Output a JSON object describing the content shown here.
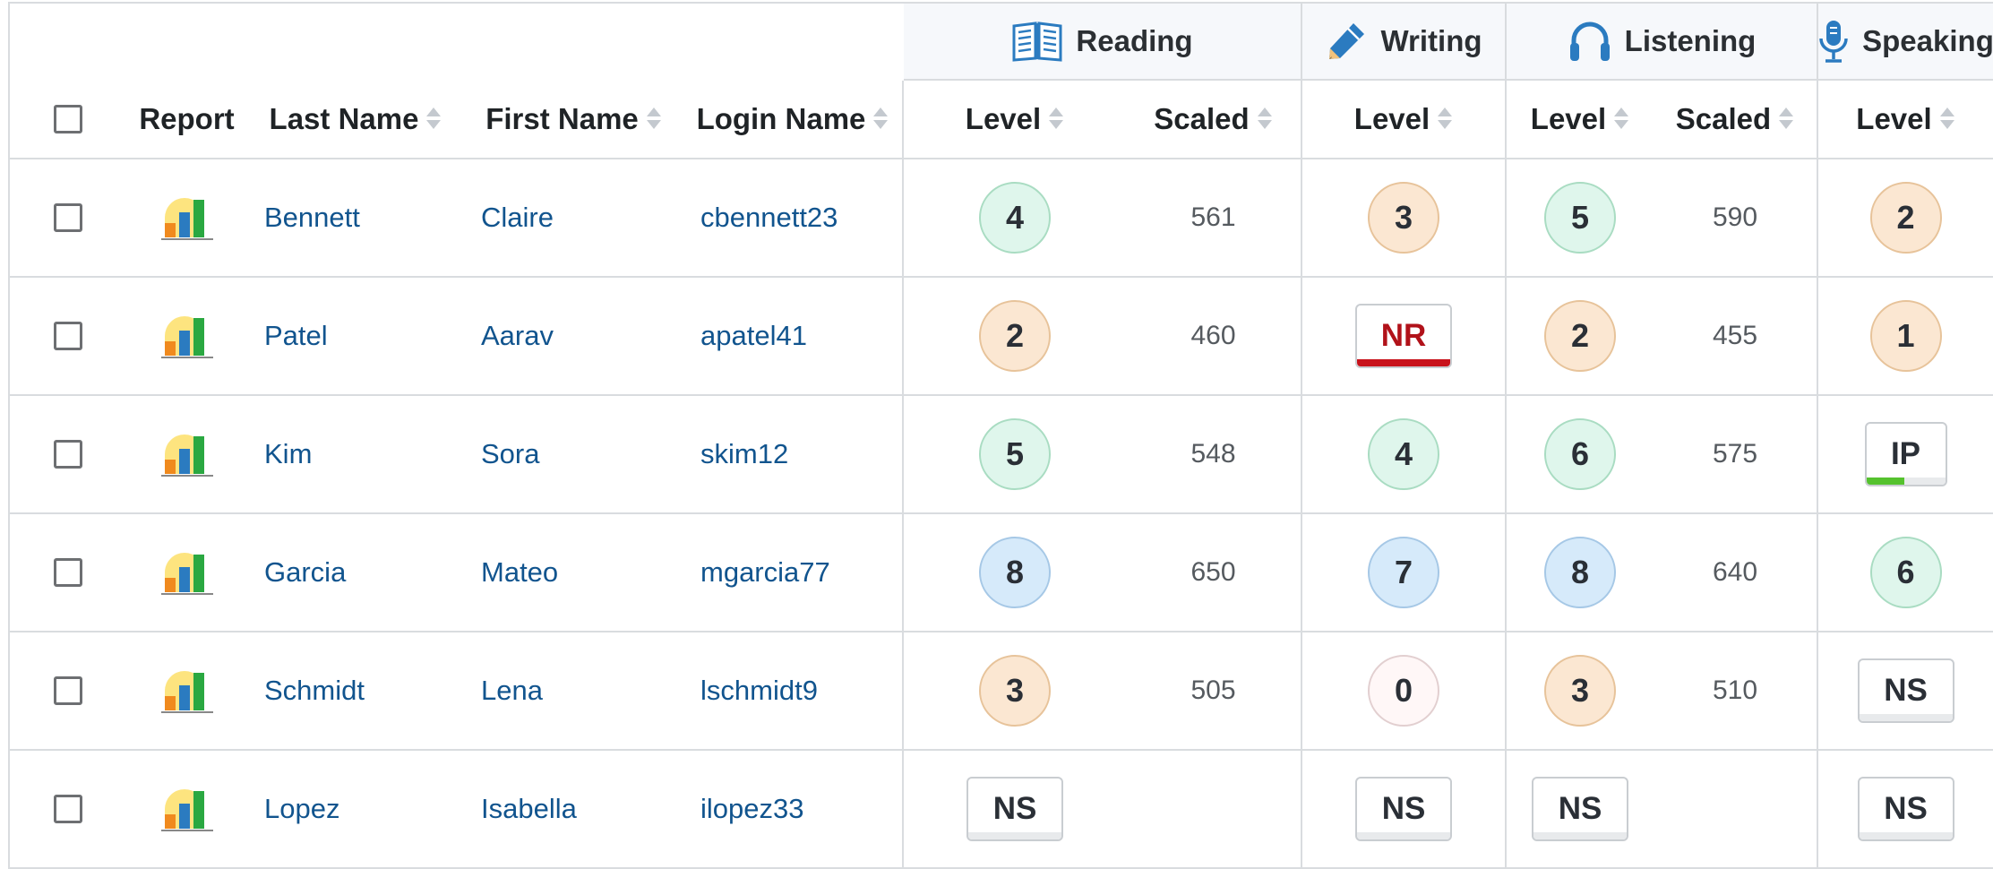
{
  "groups": {
    "reading": "Reading",
    "writing": "Writing",
    "listening": "Listening",
    "speaking": "Speaking"
  },
  "columns": {
    "report": "Report",
    "last_name": "Last Name",
    "first_name": "First Name",
    "login_name": "Login Name",
    "level": "Level",
    "scaled": "Scaled"
  },
  "icons": {
    "reading": "open-book-icon",
    "writing": "pencil-icon",
    "listening": "headphones-icon",
    "speaking": "microphone-icon",
    "report": "bar-chart-icon"
  },
  "colors": {
    "accent": "#2b7bc0",
    "link": "#11548e",
    "not_rated": "#c8121b",
    "in_progress": "#55c22e"
  },
  "rows": [
    {
      "last": "Bennett",
      "first": "Claire",
      "login": "cbennett23",
      "reading_level": "4",
      "reading_scaled": "561",
      "writing_level": "3",
      "listening_level": "5",
      "listening_scaled": "590",
      "speaking_level": "2"
    },
    {
      "last": "Patel",
      "first": "Aarav",
      "login": "apatel41",
      "reading_level": "2",
      "reading_scaled": "460",
      "writing_level": "NR",
      "listening_level": "2",
      "listening_scaled": "455",
      "speaking_level": "1"
    },
    {
      "last": "Kim",
      "first": "Sora",
      "login": "skim12",
      "reading_level": "5",
      "reading_scaled": "548",
      "writing_level": "4",
      "listening_level": "6",
      "listening_scaled": "575",
      "speaking_level": "IP"
    },
    {
      "last": "Garcia",
      "first": "Mateo",
      "login": "mgarcia77",
      "reading_level": "8",
      "reading_scaled": "650",
      "writing_level": "7",
      "listening_level": "8",
      "listening_scaled": "640",
      "speaking_level": "6"
    },
    {
      "last": "Schmidt",
      "first": "Lena",
      "login": "lschmidt9",
      "reading_level": "3",
      "reading_scaled": "505",
      "writing_level": "0",
      "listening_level": "3",
      "listening_scaled": "510",
      "speaking_level": "NS"
    },
    {
      "last": "Lopez",
      "first": "Isabella",
      "login": "ilopez33",
      "reading_level": "NS",
      "reading_scaled": "",
      "writing_level": "NS",
      "listening_level": "NS",
      "listening_scaled": "",
      "speaking_level": "NS"
    }
  ]
}
